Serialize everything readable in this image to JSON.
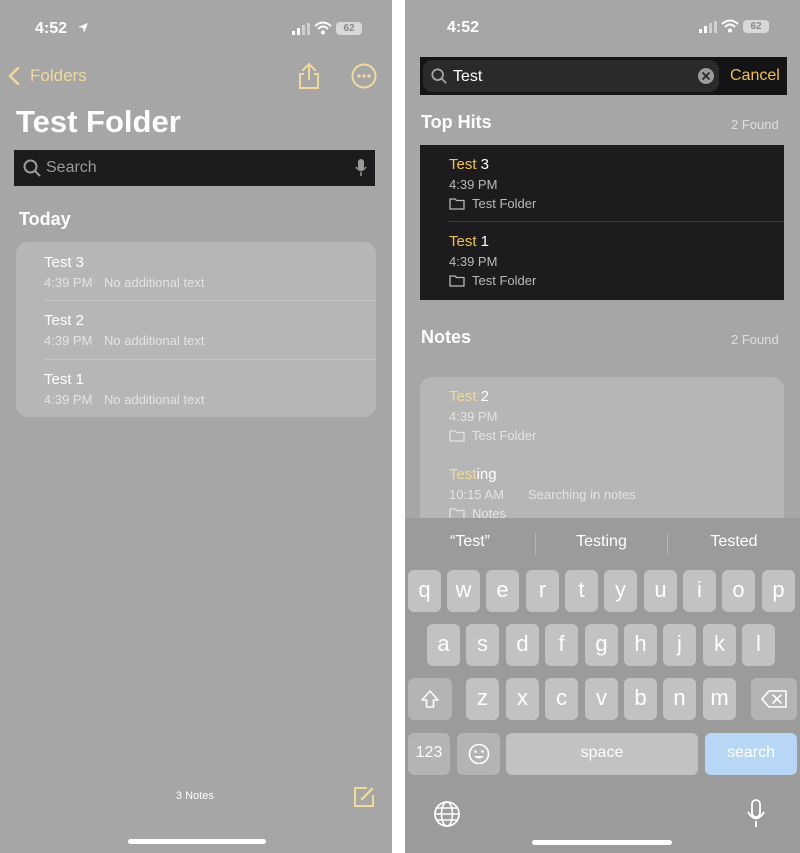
{
  "left": {
    "status": {
      "time": "4:52",
      "battery": "62"
    },
    "nav": {
      "back_label": "Folders"
    },
    "title": "Test Folder",
    "search": {
      "placeholder": "Search"
    },
    "section": "Today",
    "notes": [
      {
        "title": "Test 3",
        "time": "4:39 PM",
        "preview": "No additional text"
      },
      {
        "title": "Test 2",
        "time": "4:39 PM",
        "preview": "No additional text"
      },
      {
        "title": "Test 1",
        "time": "4:39 PM",
        "preview": "No additional text"
      }
    ],
    "footer": {
      "count": "3 Notes"
    }
  },
  "right": {
    "status": {
      "time": "4:52",
      "battery": "62"
    },
    "search": {
      "query": "Test",
      "cancel_label": "Cancel"
    },
    "top_hits": {
      "label": "Top Hits",
      "found": "2 Found",
      "items": [
        {
          "match": "Test",
          "rest": " 3",
          "time": "4:39 PM",
          "folder": "Test Folder"
        },
        {
          "match": "Test",
          "rest": " 1",
          "time": "4:39 PM",
          "folder": "Test Folder"
        }
      ]
    },
    "notes": {
      "label": "Notes",
      "found": "2 Found",
      "items": [
        {
          "match": "Test",
          "rest": " 2",
          "time": "4:39 PM",
          "preview": "",
          "folder": "Test Folder"
        },
        {
          "match": "Test",
          "rest": "ing",
          "time": "10:15 AM",
          "preview": "Searching in notes",
          "folder": "Notes"
        }
      ]
    },
    "keyboard": {
      "suggestions": [
        "“Test”",
        "Testing",
        "Tested"
      ],
      "row1": [
        "q",
        "w",
        "e",
        "r",
        "t",
        "y",
        "u",
        "i",
        "o",
        "p"
      ],
      "row2": [
        "a",
        "s",
        "d",
        "f",
        "g",
        "h",
        "j",
        "k",
        "l"
      ],
      "row3": [
        "z",
        "x",
        "c",
        "v",
        "b",
        "n",
        "m"
      ],
      "numbers_label": "123",
      "space_label": "space",
      "search_label": "search"
    }
  },
  "colors": {
    "accent": "#f0c04a",
    "accent_muted": "#f1d99a",
    "background": "#a6a6a6",
    "dark": "#1c1c1e",
    "search_key": "#b8d7f7"
  }
}
